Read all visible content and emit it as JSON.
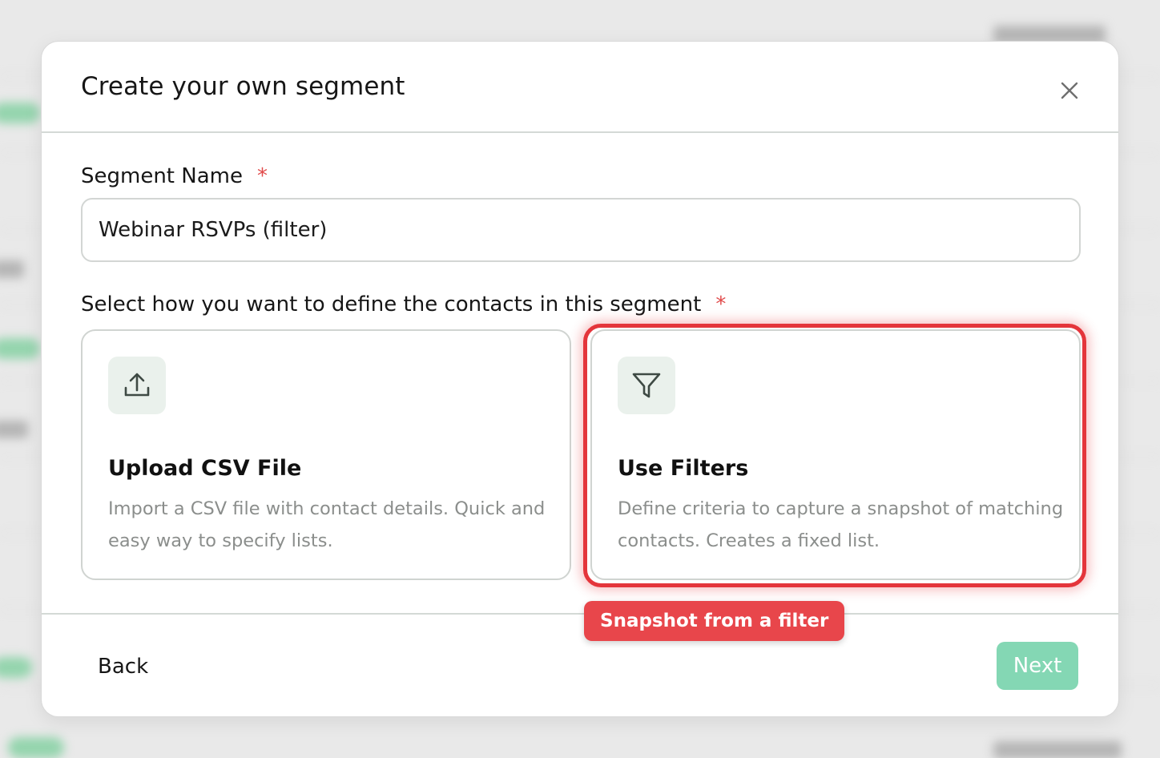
{
  "modal": {
    "title": "Create your own segment",
    "close_label": "×"
  },
  "segment_name": {
    "label": "Segment Name",
    "required_mark": "*",
    "value": "Webinar RSVPs (filter)"
  },
  "define_method": {
    "label": "Select how you want to define the contacts in this segment",
    "required_mark": "*",
    "options": [
      {
        "icon": "upload-icon",
        "title": "Upload CSV File",
        "description": "Import a CSV file with contact details. Quick and easy way to specify lists."
      },
      {
        "icon": "filter-icon",
        "title": "Use Filters",
        "description": "Define criteria to capture a snapshot of matching contacts. Creates a fixed list.",
        "highlighted": true
      }
    ]
  },
  "annotation": {
    "label": "Snapshot from a filter",
    "color": "#e8464b"
  },
  "footer": {
    "back_label": "Back",
    "next_label": "Next",
    "next_color": "#84d7b4"
  },
  "colors": {
    "required": "#e14b4b",
    "highlight": "#e4353b",
    "icon_bg": "#eaf1ec"
  }
}
